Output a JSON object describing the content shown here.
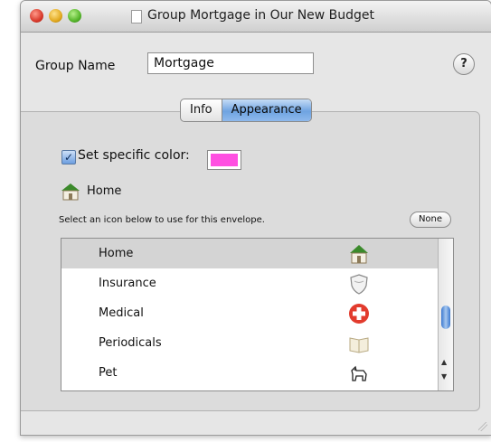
{
  "window": {
    "title": "Group Mortgage in Our New Budget"
  },
  "group": {
    "label": "Group Name",
    "value": "Mortgage",
    "help_label": "?"
  },
  "tabs": [
    {
      "label": "Info",
      "active": false
    },
    {
      "label": "Appearance",
      "active": true
    }
  ],
  "appearance": {
    "color_checkbox_label": "Set specific color:",
    "color_checked": true,
    "color_value": "#ff4fe1",
    "selected_icon_name": "Home",
    "hint": "Select an icon below to use for this envelope.",
    "none_button": "None"
  },
  "icon_list": {
    "items": [
      {
        "label": "Home",
        "icon": "home-icon",
        "selected": true
      },
      {
        "label": "Insurance",
        "icon": "shield-icon",
        "selected": false
      },
      {
        "label": "Medical",
        "icon": "medical-cross-icon",
        "selected": false
      },
      {
        "label": "Periodicals",
        "icon": "book-icon",
        "selected": false
      },
      {
        "label": "Pet",
        "icon": "dog-icon",
        "selected": false
      }
    ]
  },
  "colors": {
    "selection_blue": "#6ea3e1",
    "medical_red": "#e23b2d"
  }
}
